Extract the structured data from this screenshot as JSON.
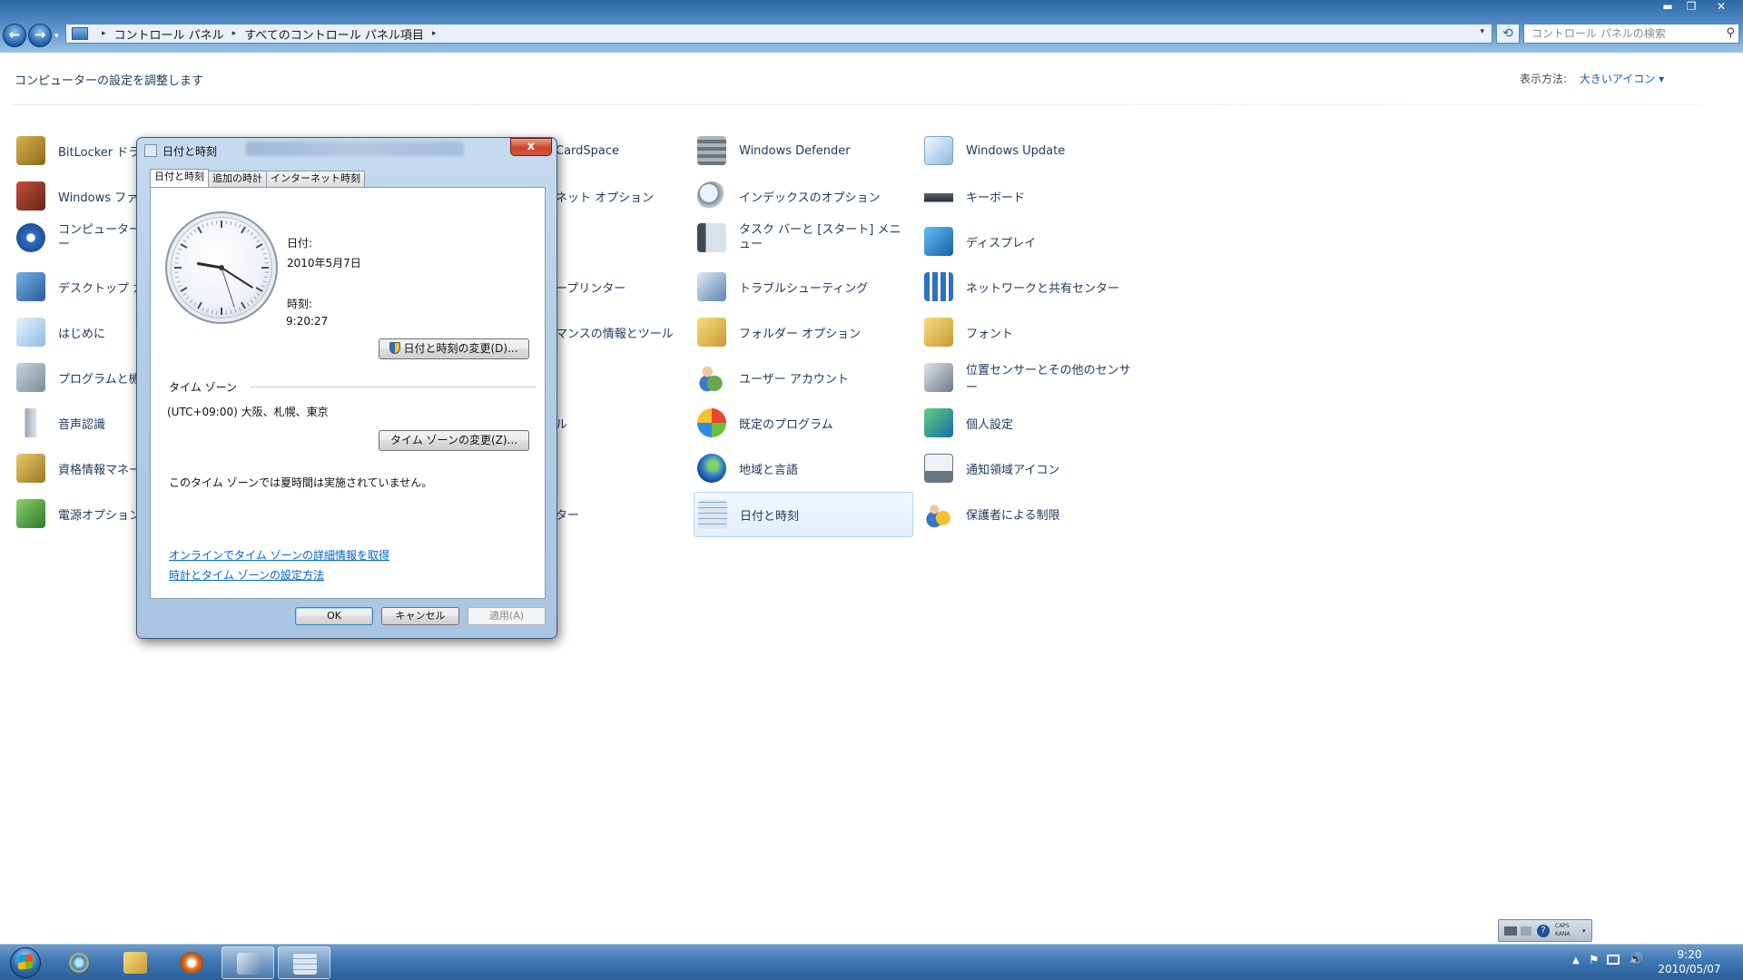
{
  "window": {
    "controls": {
      "minimize": "▬",
      "maximize": "❐",
      "close": "✕"
    }
  },
  "nav": {
    "back": "←",
    "forward": "→"
  },
  "address": {
    "crumbs": [
      "コントロール パネル",
      "すべてのコントロール パネル項目"
    ],
    "separator": "▸"
  },
  "search": {
    "placeholder": "コントロール パネルの検索"
  },
  "header": {
    "adjust_text": "コンピューターの設定を調整します",
    "view_by_label": "表示方法:",
    "view_by_value": "大きいアイコン ▾"
  },
  "items": {
    "col1": [
      {
        "label": "BitLocker ドラ"
      },
      {
        "label": "Windows ファイ"
      },
      {
        "label": "コンピューターの"
      },
      {
        "label": "デスクトップ ガ"
      },
      {
        "label": "はじめに"
      },
      {
        "label": "プログラムと機能"
      },
      {
        "label": "音声認識"
      },
      {
        "label": "資格情報マネー"
      },
      {
        "label": "電源オプション"
      }
    ],
    "col1_wrap": "ー",
    "col3": [
      {
        "label": "CardSpace"
      },
      {
        "label": "ネット オプション"
      },
      {
        "label": "ープリンター"
      },
      {
        "label": "マンスの情報とツール"
      },
      {
        "label": "ル"
      },
      {
        "label": "ター"
      }
    ],
    "col4": [
      {
        "label": "Windows Defender"
      },
      {
        "label": "インデックスのオプション"
      },
      {
        "label": "タスク バーと [スタート] メニュー"
      },
      {
        "label": "トラブルシューティング"
      },
      {
        "label": "フォルダー オプション"
      },
      {
        "label": "ユーザー アカウント"
      },
      {
        "label": "既定のプログラム"
      },
      {
        "label": "地域と言語"
      },
      {
        "label": "日付と時刻"
      }
    ],
    "col5": [
      {
        "label": "Windows Update"
      },
      {
        "label": "キーボード"
      },
      {
        "label": "ディスプレイ"
      },
      {
        "label": "ネットワークと共有センター"
      },
      {
        "label": "フォント"
      },
      {
        "label": "位置センサーとその他のセンサー"
      },
      {
        "label": "個人設定"
      },
      {
        "label": "通知領域アイコン"
      },
      {
        "label": "保護者による制限"
      }
    ]
  },
  "dialog": {
    "title": "日付と時刻",
    "close": "x",
    "tabs": [
      "日付と時刻",
      "追加の時計",
      "インターネット時刻"
    ],
    "date_label": "日付:",
    "date_value": "2010年5月7日",
    "time_label": "時刻:",
    "time_value": "9:20:27",
    "change_datetime_button": "日付と時刻の変更(D)...",
    "timezone_heading": "タイム ゾーン",
    "timezone_value": "(UTC+09:00) 大阪、札幌、東京",
    "change_timezone_button": "タイム ゾーンの変更(Z)...",
    "dst_note": "このタイム ゾーンでは夏時間は実施されていません。",
    "link_online": "オンラインでタイム ゾーンの詳細情報を取得",
    "link_howto": "時計とタイム ゾーンの設定方法",
    "ok": "OK",
    "cancel": "キャンセル",
    "apply": "適用(A)",
    "clock_time": {
      "hour": 9,
      "minute": 20,
      "second": 27
    }
  },
  "taskbar": {
    "clock_time": "9:20",
    "clock_date": "2010/05/07",
    "langbar_caps": "CAPS",
    "langbar_kana": "KANA"
  },
  "colors": {
    "link": "#0066cc",
    "item_text": "#1e395b",
    "taskbar": "#3f78b4"
  }
}
